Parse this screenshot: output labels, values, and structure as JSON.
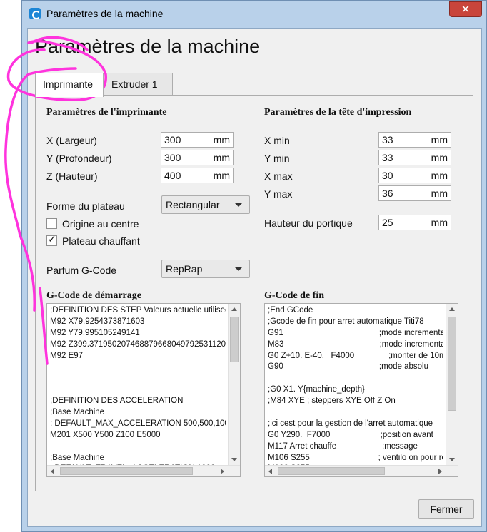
{
  "window": {
    "title": "Paramètres de la machine",
    "close_glyph": "✕"
  },
  "dialog": {
    "title": "Paramètres de la machine"
  },
  "tabs": [
    {
      "label": "Imprimante",
      "active": true
    },
    {
      "label": "Extruder 1",
      "active": false
    }
  ],
  "printer": {
    "heading": "Paramètres de l'imprimante",
    "x": {
      "label": "X (Largeur)",
      "value": "300",
      "unit": "mm"
    },
    "y": {
      "label": "Y (Profondeur)",
      "value": "300",
      "unit": "mm"
    },
    "z": {
      "label": "Z (Hauteur)",
      "value": "400",
      "unit": "mm"
    },
    "bed_shape": {
      "label": "Forme du plateau",
      "value": "Rectangular"
    },
    "origin_center": {
      "label": "Origine au centre",
      "checked": false
    },
    "heated_bed": {
      "label": "Plateau chauffant",
      "checked": true,
      "mark": "✓"
    },
    "gcode_flavor": {
      "label": "Parfum G-Code",
      "value": "RepRap"
    }
  },
  "head": {
    "heading": "Paramètres de la tête d'impression",
    "xmin": {
      "label": "X min",
      "value": "33",
      "unit": "mm"
    },
    "ymin": {
      "label": "Y min",
      "value": "33",
      "unit": "mm"
    },
    "xmax": {
      "label": "X max",
      "value": "30",
      "unit": "mm"
    },
    "ymax": {
      "label": "Y max",
      "value": "36",
      "unit": "mm"
    },
    "gantry": {
      "label": "Hauteur du portique",
      "value": "25",
      "unit": "mm"
    }
  },
  "start_gcode": {
    "heading": "G-Code de démarrage",
    "lines": [
      ";DEFINITION DES STEP Valeurs actuelle utilisees",
      "M92 X79.9254373871603",
      "M92 Y79.995105249141",
      "M92 Z399.371950207468879668049792531120",
      "M92 E97",
      "",
      "",
      "",
      ";DEFINITION DES ACCELERATION",
      ";Base Machine",
      "; DEFAULT_MAX_ACCELERATION 500,500,100,5000",
      "M201 X500 Y500 Z100 E5000",
      "",
      ";Base Machine",
      "; DEFAULT_TRAVEL_ACCELERATION 1000"
    ]
  },
  "end_gcode": {
    "heading": "G-Code de fin",
    "lines": [
      ";End GCode",
      ";Gcode de fin pour arret automatique Titi78",
      "G91                                          ;mode incremental",
      "M83                                          ;mode incremental",
      "G0 Z+10. E-40.   F4000               ;monter de 10mm",
      "G90                                          ;mode absolu",
      "",
      ";G0 X1. Y{machine_depth}",
      ";M84 XYE ; steppers XYE Off Z On",
      "",
      ";ici cest pour la gestion de l'arret automatique",
      "G0 Y290.  F7000                      ;position avant",
      "M117 Arret chauffe                    ;message",
      "M106 S255                              ; ventilo on pour refroidir",
      "M106 S255"
    ]
  },
  "footer": {
    "close_label": "Fermer"
  },
  "colors": {
    "window_frame": "#b9d1ea",
    "close_red": "#c9453b",
    "annotation": "#ff33dd"
  }
}
